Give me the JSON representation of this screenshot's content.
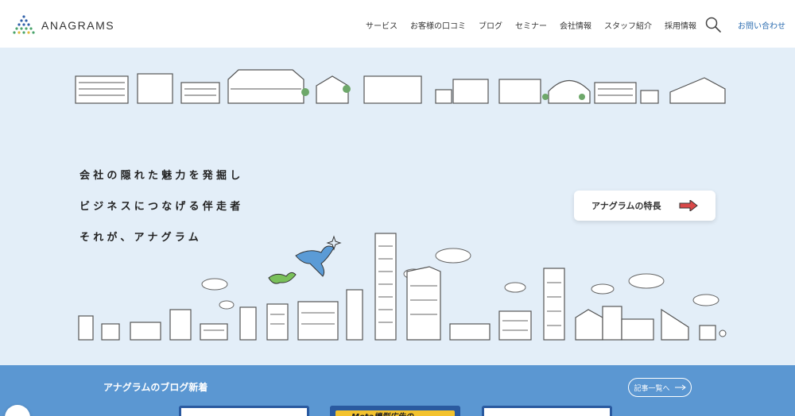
{
  "header": {
    "logo_text": "ANAGRAMS",
    "nav": [
      {
        "label": "サービス"
      },
      {
        "label": "お客様の口コミ"
      },
      {
        "label": "ブログ"
      },
      {
        "label": "セミナー"
      },
      {
        "label": "会社情報"
      },
      {
        "label": "スタッフ紹介"
      },
      {
        "label": "採用情報"
      }
    ],
    "contact_label": "お問い合わせ"
  },
  "hero": {
    "lines": [
      "会社の隠れた魅力を発掘し",
      "ビジネスにつなげる伴走者",
      "それが、アナグラム"
    ],
    "feature_button": "アナグラムの特長"
  },
  "blog": {
    "title": "アナグラムのブログ新着",
    "more_label": "記事一覧へ",
    "card2_text": "Meta機型広告の"
  },
  "colors": {
    "hero_bg": "#e3eef8",
    "blog_bg": "#5b97d2",
    "accent_blue": "#2b6cb0",
    "arrow_red": "#d94848"
  }
}
